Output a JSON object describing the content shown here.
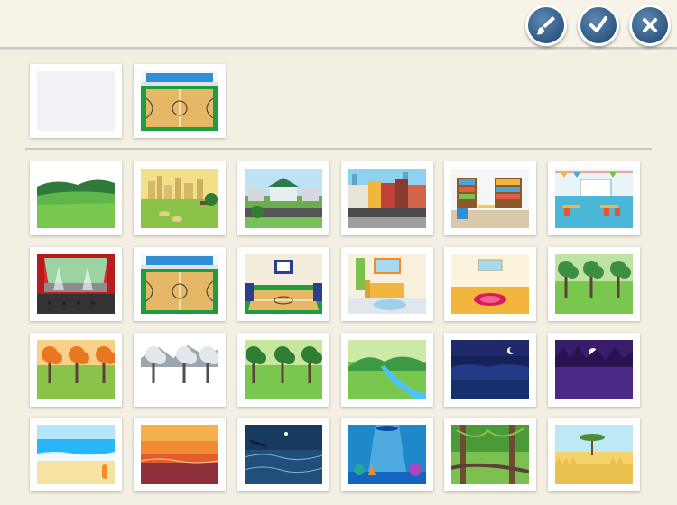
{
  "toolbar": {
    "buttons": [
      {
        "name": "paint-brush-button",
        "icon": "paint-brush-icon"
      },
      {
        "name": "confirm-button",
        "icon": "checkmark-icon"
      },
      {
        "name": "close-button",
        "icon": "close-icon"
      }
    ]
  },
  "colors": {
    "button_blue": "#2f5882",
    "page_background": "#f3efe2"
  },
  "selected_backgrounds": [
    {
      "scene": "blank"
    },
    {
      "scene": "basketball-court-top"
    }
  ],
  "background_library": [
    {
      "scene": "green-hills"
    },
    {
      "scene": "park-city-skyline"
    },
    {
      "scene": "suburban-street"
    },
    {
      "scene": "city-street"
    },
    {
      "scene": "library"
    },
    {
      "scene": "classroom"
    },
    {
      "scene": "theater-stage"
    },
    {
      "scene": "basketball-court-top"
    },
    {
      "scene": "basketball-court-front"
    },
    {
      "scene": "bedroom"
    },
    {
      "scene": "empty-room"
    },
    {
      "scene": "spring-forest"
    },
    {
      "scene": "autumn-forest"
    },
    {
      "scene": "winter-forest"
    },
    {
      "scene": "summer-forest"
    },
    {
      "scene": "river-valley"
    },
    {
      "scene": "night-moon"
    },
    {
      "scene": "night-purple"
    },
    {
      "scene": "beach"
    },
    {
      "scene": "sunset-sea"
    },
    {
      "scene": "night-ocean"
    },
    {
      "scene": "underwater"
    },
    {
      "scene": "jungle"
    },
    {
      "scene": "savanna"
    }
  ]
}
